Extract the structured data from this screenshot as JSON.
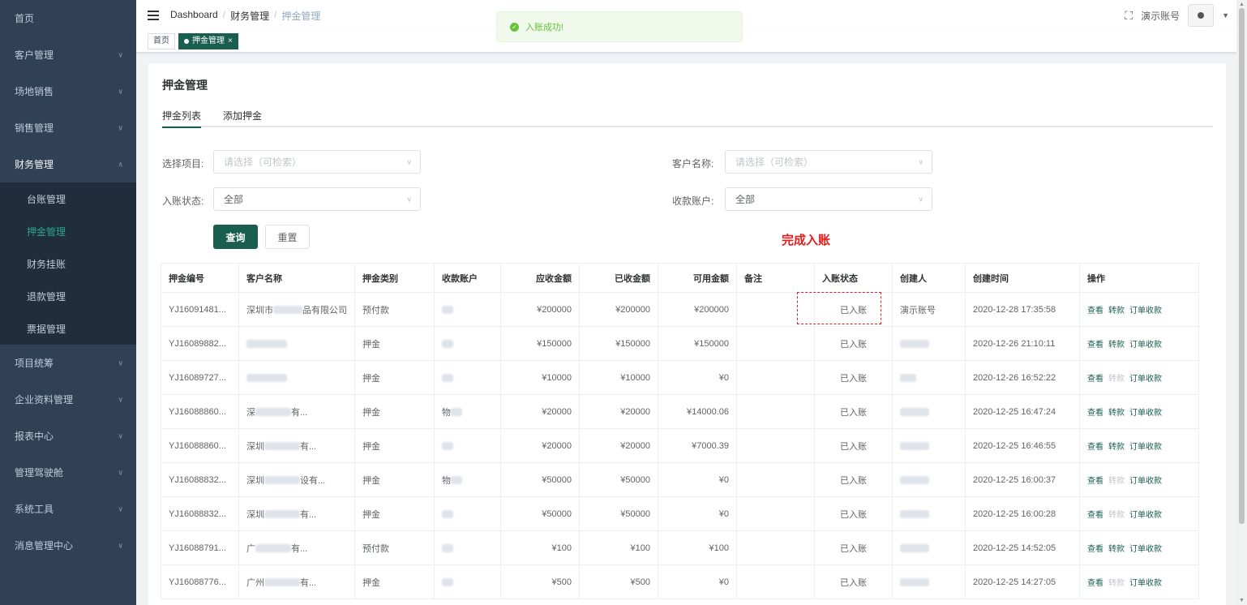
{
  "sidebar": {
    "items": [
      {
        "label": "首页",
        "has_children": false
      },
      {
        "label": "客户管理",
        "has_children": true
      },
      {
        "label": "场地销售",
        "has_children": true
      },
      {
        "label": "销售管理",
        "has_children": true
      },
      {
        "label": "财务管理",
        "has_children": true,
        "expanded": true
      }
    ],
    "sub_items": [
      {
        "label": "台账管理"
      },
      {
        "label": "押金管理",
        "active": true
      },
      {
        "label": "财务挂账"
      },
      {
        "label": "退款管理"
      },
      {
        "label": "票据管理"
      }
    ],
    "items_after": [
      {
        "label": "项目统筹"
      },
      {
        "label": "企业资料管理"
      },
      {
        "label": "报表中心"
      },
      {
        "label": "管理驾驶舱"
      },
      {
        "label": "系统工具"
      },
      {
        "label": "消息管理中心"
      }
    ]
  },
  "header": {
    "breadcrumb": [
      "Dashboard",
      "财务管理",
      "押金管理"
    ],
    "account_name": "演示账号"
  },
  "tags": [
    {
      "label": "首页",
      "active": false
    },
    {
      "label": "押金管理",
      "active": true,
      "close": "×"
    }
  ],
  "toast": {
    "message": "入账成功!"
  },
  "page": {
    "title": "押金管理",
    "tabs": [
      {
        "label": "押金列表",
        "active": true
      },
      {
        "label": "添加押金",
        "active": false
      }
    ]
  },
  "filters": {
    "project_label": "选择项目:",
    "project_placeholder": "请选择（可检索）",
    "customer_label": "客户名称:",
    "customer_placeholder": "请选择（可检索）",
    "status_label": "入账状态:",
    "status_value": "全部",
    "account_label": "收款账户:",
    "account_value": "全部",
    "query_button": "查询",
    "reset_button": "重置"
  },
  "annotation": "完成入账",
  "table": {
    "headers": [
      "押金编号",
      "客户名称",
      "押金类别",
      "收款账户",
      "应收金额",
      "已收金额",
      "可用金额",
      "备注",
      "入账状态",
      "创建人",
      "创建时间",
      "操作"
    ],
    "rows": [
      {
        "id": "YJ16091481...",
        "customer": "深圳市",
        "customer_suffix": "品有限公司",
        "type": "预付款",
        "receivable": "¥200000",
        "received": "¥200000",
        "available": "¥200000",
        "status": "已入账",
        "creator": "演示账号",
        "created": "2020-12-28 17:35:58",
        "transfer_enabled": true
      },
      {
        "id": "YJ16089882...",
        "customer": "",
        "customer_suffix": "",
        "type": "押金",
        "receivable": "¥150000",
        "received": "¥150000",
        "available": "¥150000",
        "status": "已入账",
        "creator": "",
        "created": "2020-12-26 21:10:11",
        "transfer_enabled": true
      },
      {
        "id": "YJ16089727...",
        "customer": "",
        "customer_suffix": "",
        "type": "押金",
        "receivable": "¥10000",
        "received": "¥10000",
        "available": "¥0",
        "status": "已入账",
        "creator": "",
        "created": "2020-12-26 16:52:22",
        "transfer_enabled": false
      },
      {
        "id": "YJ16088860...",
        "customer": "深",
        "customer_suffix": "有...",
        "type": "押金",
        "account": "物",
        "receivable": "¥20000",
        "received": "¥20000",
        "available": "¥14000.06",
        "status": "已入账",
        "creator": "",
        "created": "2020-12-25 16:47:24",
        "transfer_enabled": true
      },
      {
        "id": "YJ16088860...",
        "customer": "深圳",
        "customer_suffix": "有...",
        "type": "押金",
        "receivable": "¥20000",
        "received": "¥20000",
        "available": "¥7000.39",
        "status": "已入账",
        "creator": "",
        "created": "2020-12-25 16:46:55",
        "transfer_enabled": true
      },
      {
        "id": "YJ16088832...",
        "customer": "深圳",
        "customer_suffix": "设有...",
        "type": "押金",
        "account": "物",
        "receivable": "¥50000",
        "received": "¥50000",
        "available": "¥0",
        "status": "已入账",
        "creator": "",
        "created": "2020-12-25 16:00:37",
        "transfer_enabled": false
      },
      {
        "id": "YJ16088832...",
        "customer": "深圳",
        "customer_suffix": "有...",
        "type": "押金",
        "receivable": "¥50000",
        "received": "¥50000",
        "available": "¥0",
        "status": "已入账",
        "creator": "",
        "created": "2020-12-25 16:00:28",
        "transfer_enabled": false
      },
      {
        "id": "YJ16088791...",
        "customer": "广",
        "customer_suffix": "有...",
        "type": "预付款",
        "receivable": "¥100",
        "received": "¥100",
        "available": "¥100",
        "status": "已入账",
        "creator": "",
        "created": "2020-12-25 14:52:05",
        "transfer_enabled": true
      },
      {
        "id": "YJ16088776...",
        "customer": "广州",
        "customer_suffix": "有...",
        "type": "押金",
        "receivable": "¥500",
        "received": "¥500",
        "available": "¥0",
        "status": "已入账",
        "creator": "",
        "created": "2020-12-25 14:27:05",
        "transfer_enabled": false
      }
    ],
    "ops": {
      "view": "查看",
      "transfer": "转款",
      "order_collect": "订单收款"
    }
  },
  "colors": {
    "primary": "#1a5e50",
    "sidebar_bg": "#304156",
    "submenu_bg": "#1f2d3d",
    "accent_red": "#e02020",
    "success": "#67c23a"
  }
}
